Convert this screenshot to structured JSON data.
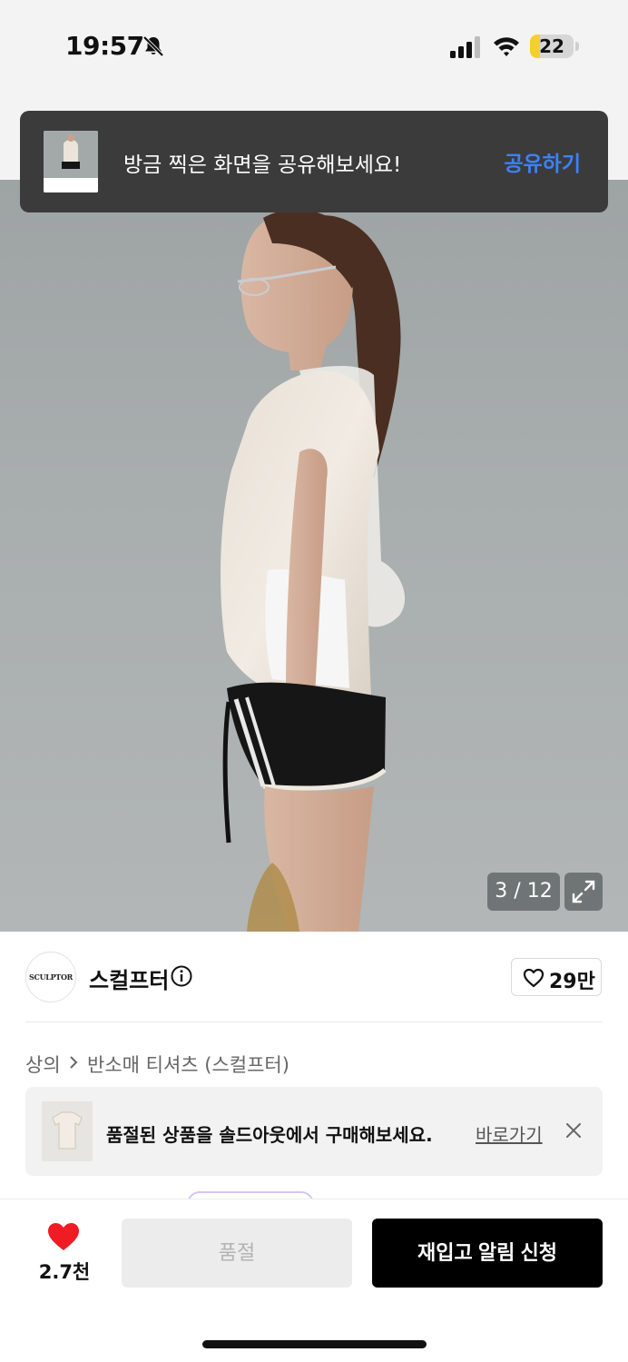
{
  "status_bar": {
    "time": "19:57",
    "battery_percent": "22",
    "battery_level": 0.22,
    "icons": [
      "bell-slash-icon",
      "cellular-signal-icon",
      "wifi-icon",
      "battery-icon"
    ]
  },
  "toast": {
    "message": "방금 찍은 화면을 공유해보세요!",
    "action_label": "공유하기"
  },
  "gallery": {
    "counter": "3 / 12",
    "current_index": 3,
    "total": 12
  },
  "brand": {
    "logo_text": "SCULPTOR",
    "name": "스컬프터",
    "like_count": "29만"
  },
  "breadcrumb": {
    "category": "상의",
    "subcategory": "반소매 티셔츠 (스컬프터)"
  },
  "soldout_banner": {
    "text": "품절된 상품을 솔드아웃에서 구매해보세요.",
    "link_label": "바로가기"
  },
  "bottom_bar": {
    "favorite_count": "2.7천",
    "soldout_label": "품절",
    "restock_label": "재입고 알림 신청"
  },
  "colors": {
    "accent_blue": "#3b82f6",
    "heart_red": "#ef1c24",
    "battery_yellow": "#f7cf2b",
    "toast_bg": "#3b3b3b"
  }
}
